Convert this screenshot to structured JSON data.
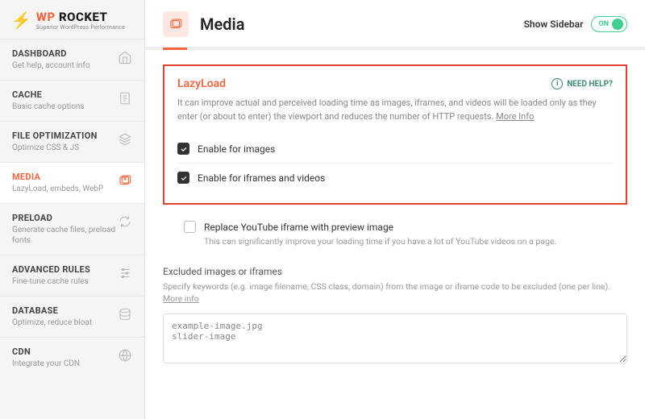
{
  "brand": {
    "prefix": "WP",
    "suffix": " ROCKET",
    "tagline": "Superior WordPress Performance"
  },
  "nav": [
    {
      "title": "DASHBOARD",
      "desc": "Get help, account info"
    },
    {
      "title": "CACHE",
      "desc": "Basic cache options"
    },
    {
      "title": "FILE OPTIMIZATION",
      "desc": "Optimize CSS & JS"
    },
    {
      "title": "MEDIA",
      "desc": "LazyLoad, embeds, WebP"
    },
    {
      "title": "PRELOAD",
      "desc": "Generate cache files, preload fonts"
    },
    {
      "title": "ADVANCED RULES",
      "desc": "Fine-tune cache rules"
    },
    {
      "title": "DATABASE",
      "desc": "Optimize, reduce bloat"
    },
    {
      "title": "CDN",
      "desc": "Integrate your CDN"
    }
  ],
  "header": {
    "title": "Media",
    "show_sidebar": "Show Sidebar",
    "toggle": "ON"
  },
  "lazy": {
    "title": "LazyLoad",
    "help": "NEED HELP?",
    "desc": "It can improve actual and perceived loading time as images, iframes, and videos will be loaded only as they enter (or about to enter) the viewport and reduces the number of HTTP requests. ",
    "more": "More Info",
    "opt1": "Enable for images",
    "opt2": "Enable for iframes and videos"
  },
  "youtube": {
    "label": "Replace YouTube iframe with preview image",
    "desc": "This can significantly improve your loading time if you have a lot of YouTube videos on a page."
  },
  "excluded": {
    "title": "Excluded images or iframes",
    "desc": "Specify keywords (e.g. image filename, CSS class, domain) from the image or iframe code to be excluded (one per line). ",
    "more": "More info",
    "value": "example-image.jpg\nslider-image"
  }
}
